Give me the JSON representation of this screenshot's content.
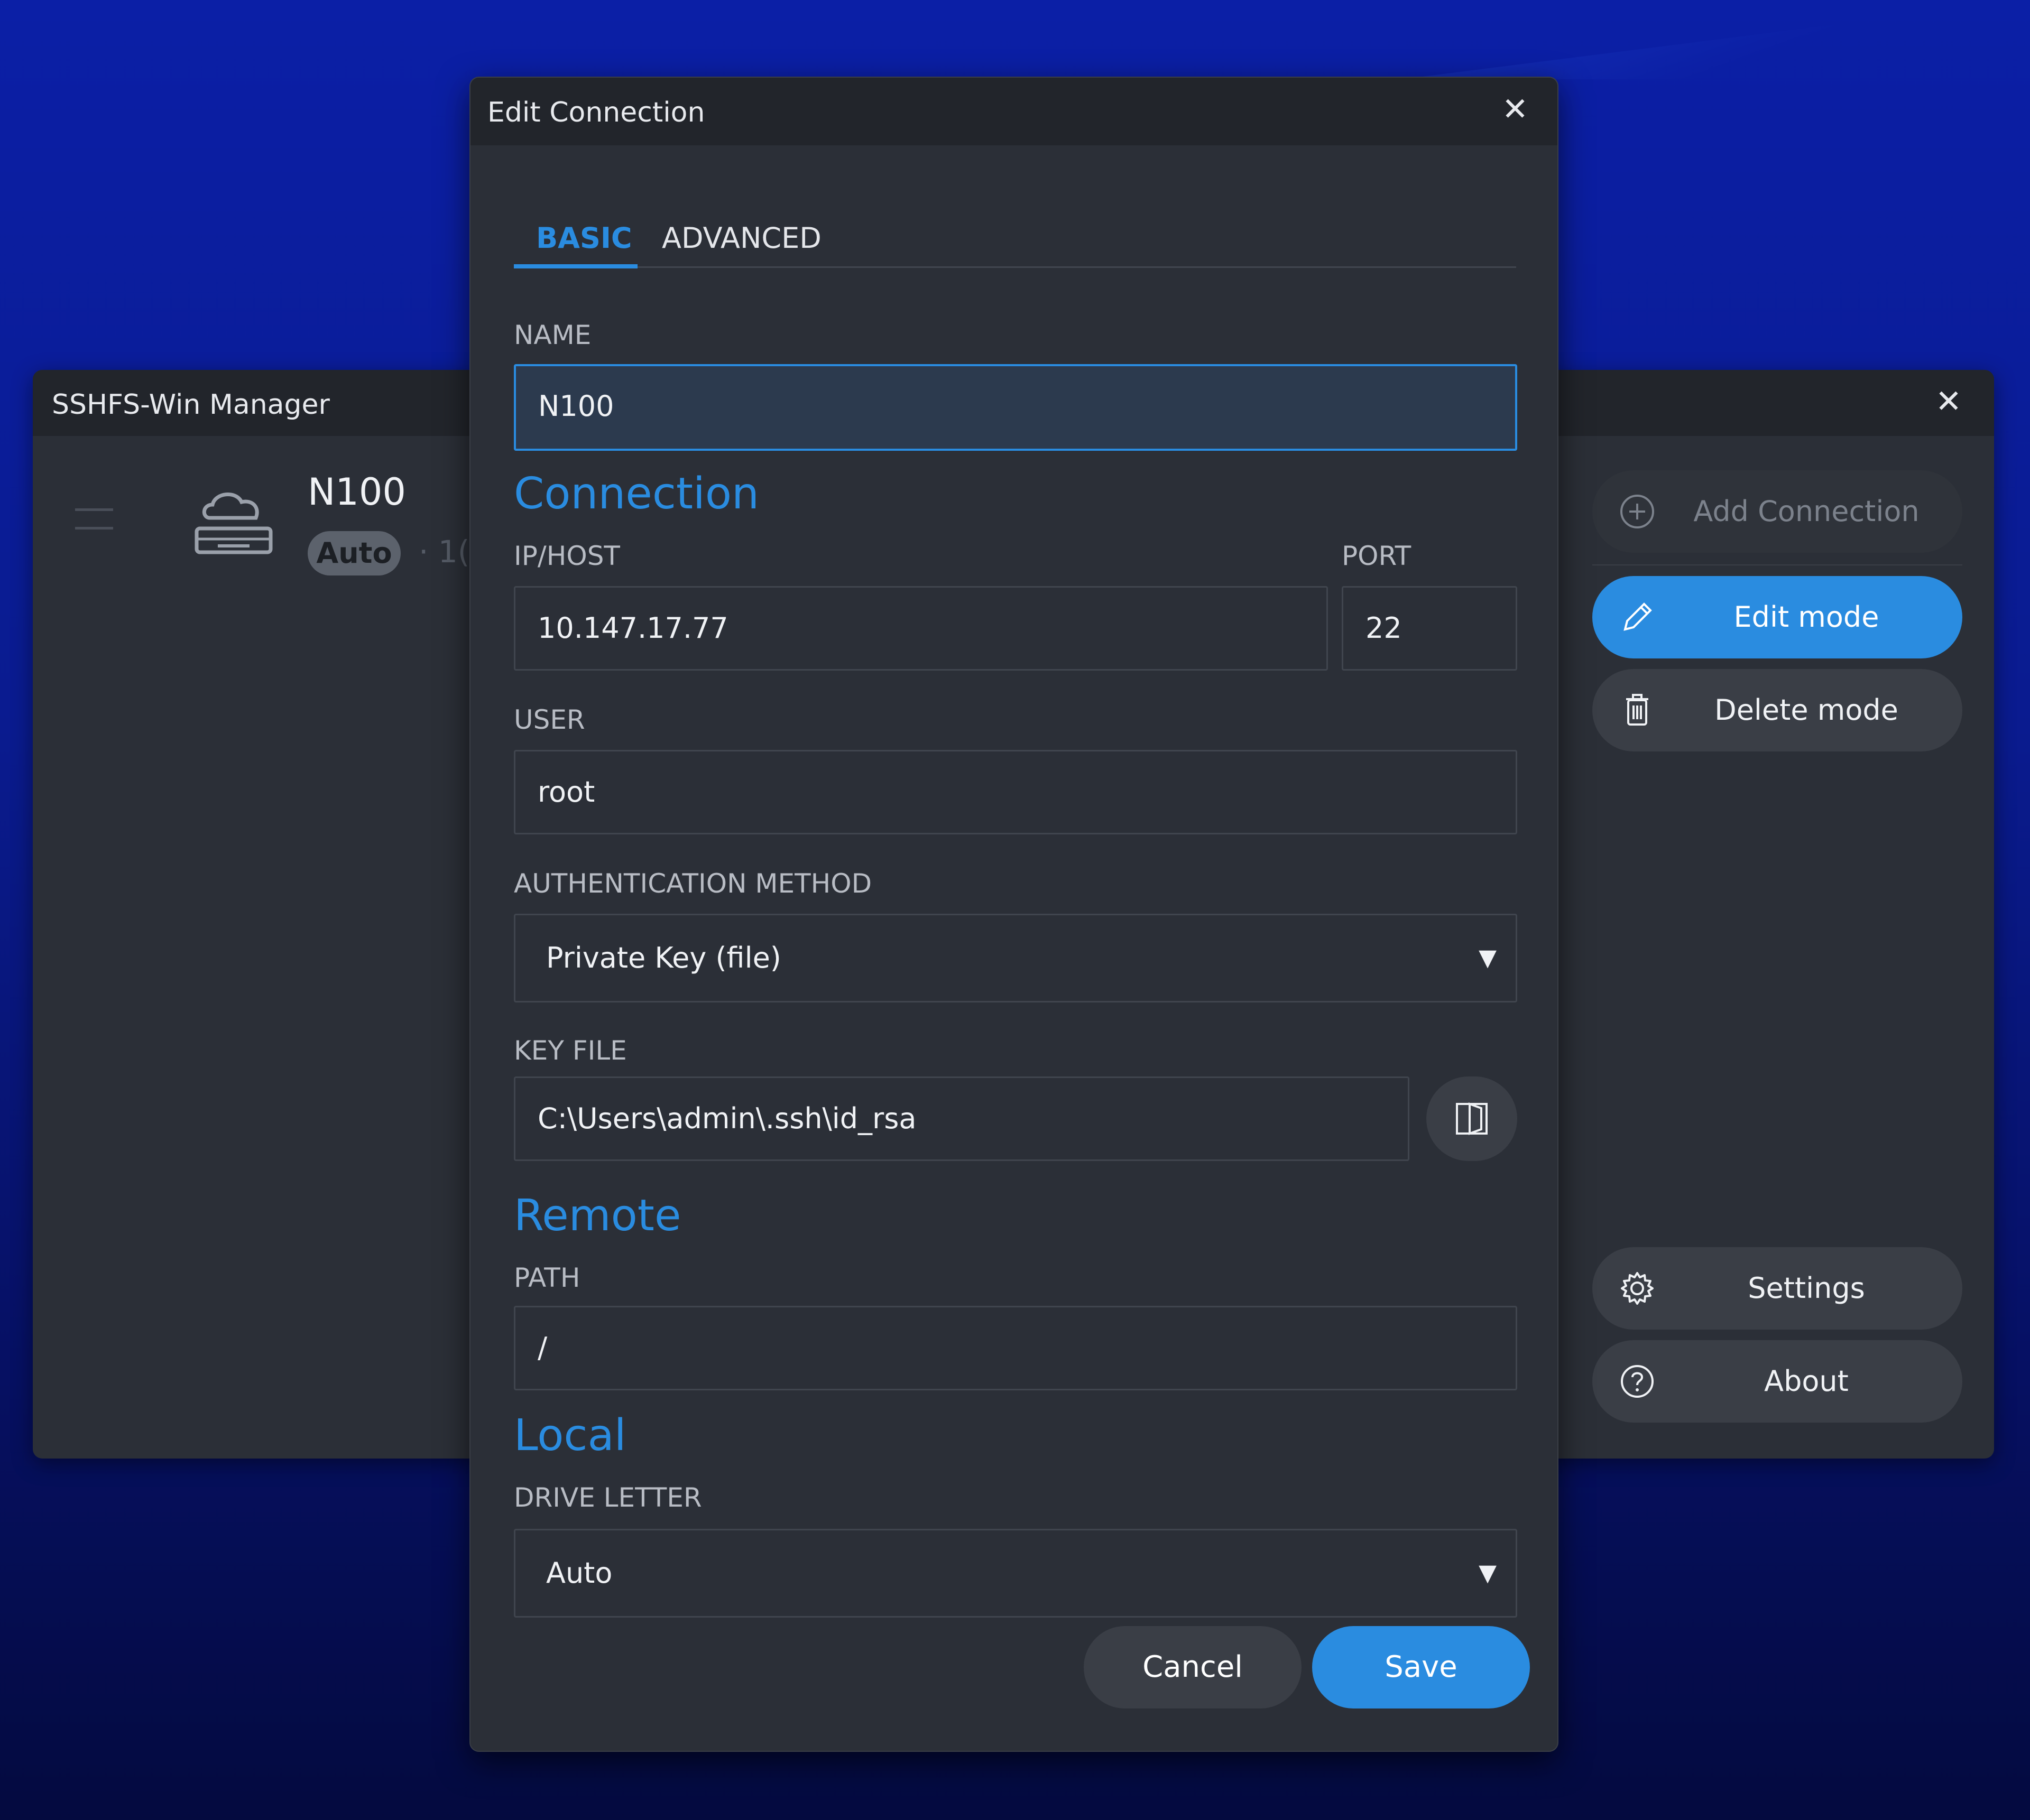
{
  "main_window": {
    "title": "SSHFS-Win Manager",
    "connection": {
      "name": "N100",
      "badge": "Auto",
      "subtitle": "· 1("
    },
    "sidebar": {
      "add_connection": "Add Connection",
      "edit_mode": "Edit mode",
      "delete_mode": "Delete mode",
      "settings": "Settings",
      "about": "About"
    }
  },
  "dialog": {
    "title": "Edit Connection",
    "tabs": [
      {
        "label": "BASIC",
        "active": true
      },
      {
        "label": "ADVANCED",
        "active": false
      }
    ],
    "fields": {
      "name_label": "NAME",
      "name_value": "N100",
      "section_connection": "Connection",
      "host_label": "IP/HOST",
      "host_value": "10.147.17.77",
      "port_label": "PORT",
      "port_value": "22",
      "user_label": "USER",
      "user_value": "root",
      "auth_label": "AUTHENTICATION METHOD",
      "auth_value": "Private Key (file)",
      "keyfile_label": "KEY FILE",
      "keyfile_value": "C:\\Users\\admin\\.ssh\\id_rsa",
      "section_remote": "Remote",
      "path_label": "PATH",
      "path_value": "/",
      "section_local": "Local",
      "drive_label": "DRIVE LETTER",
      "drive_value": "Auto"
    },
    "buttons": {
      "cancel": "Cancel",
      "save": "Save"
    }
  },
  "colors": {
    "accent": "#2a8ce0",
    "window_bg": "#2b2f37",
    "titlebar_bg": "#22252b"
  }
}
